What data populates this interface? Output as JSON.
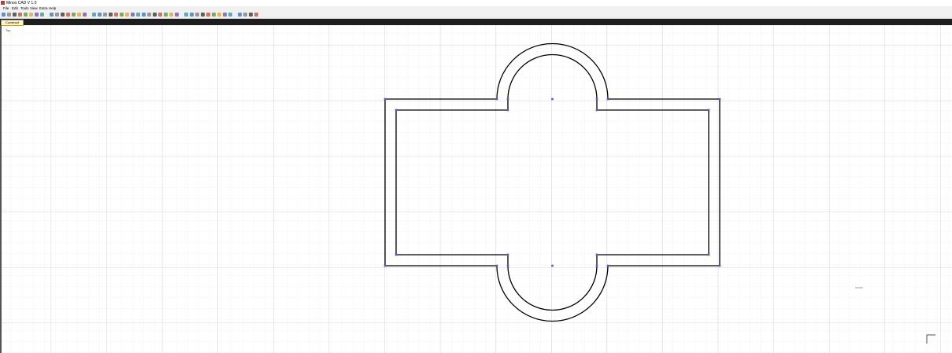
{
  "window": {
    "title": "Minos CAD V 1.0"
  },
  "menu": [
    "File",
    "Edit",
    "Tools",
    "View",
    "Extra",
    "Help"
  ],
  "tabs": {
    "active_label": "Construct"
  },
  "view": {
    "label": "Top"
  },
  "toolbar_icons": [
    "new-file-icon",
    "open-folder-icon",
    "save-icon",
    "print-icon",
    "cut-icon",
    "copy-icon",
    "paste-icon",
    "undo-icon",
    "redo-icon",
    "layer-icon",
    "select-icon",
    "window-icon",
    "pan-icon",
    "zoom-icon",
    "zoom-window-icon",
    "snap-icon",
    "grid-icon",
    "point-icon",
    "line-icon",
    "polyline-icon",
    "rectangle-icon",
    "circle-icon",
    "arc-icon",
    "ellipse-icon",
    "spline-icon",
    "text-icon",
    "dimension-icon",
    "hatch-icon",
    "block-icon",
    "move-icon",
    "rotate-icon",
    "scale-icon",
    "mirror-icon",
    "offset-icon",
    "trim-icon",
    "extend-icon",
    "fillet-icon",
    "chamfer-icon",
    "measure-icon",
    "properties-icon",
    "render-icon",
    "camera-icon",
    "light-icon",
    "material-icon"
  ],
  "colors": {
    "drawing_line": "#000000",
    "handle": "#5a5ad0",
    "grid_minor": "#ececec",
    "grid_major": "#c8c8c8",
    "dark_bar": "#1e1e1e",
    "active_tab": "#fff4c8"
  }
}
